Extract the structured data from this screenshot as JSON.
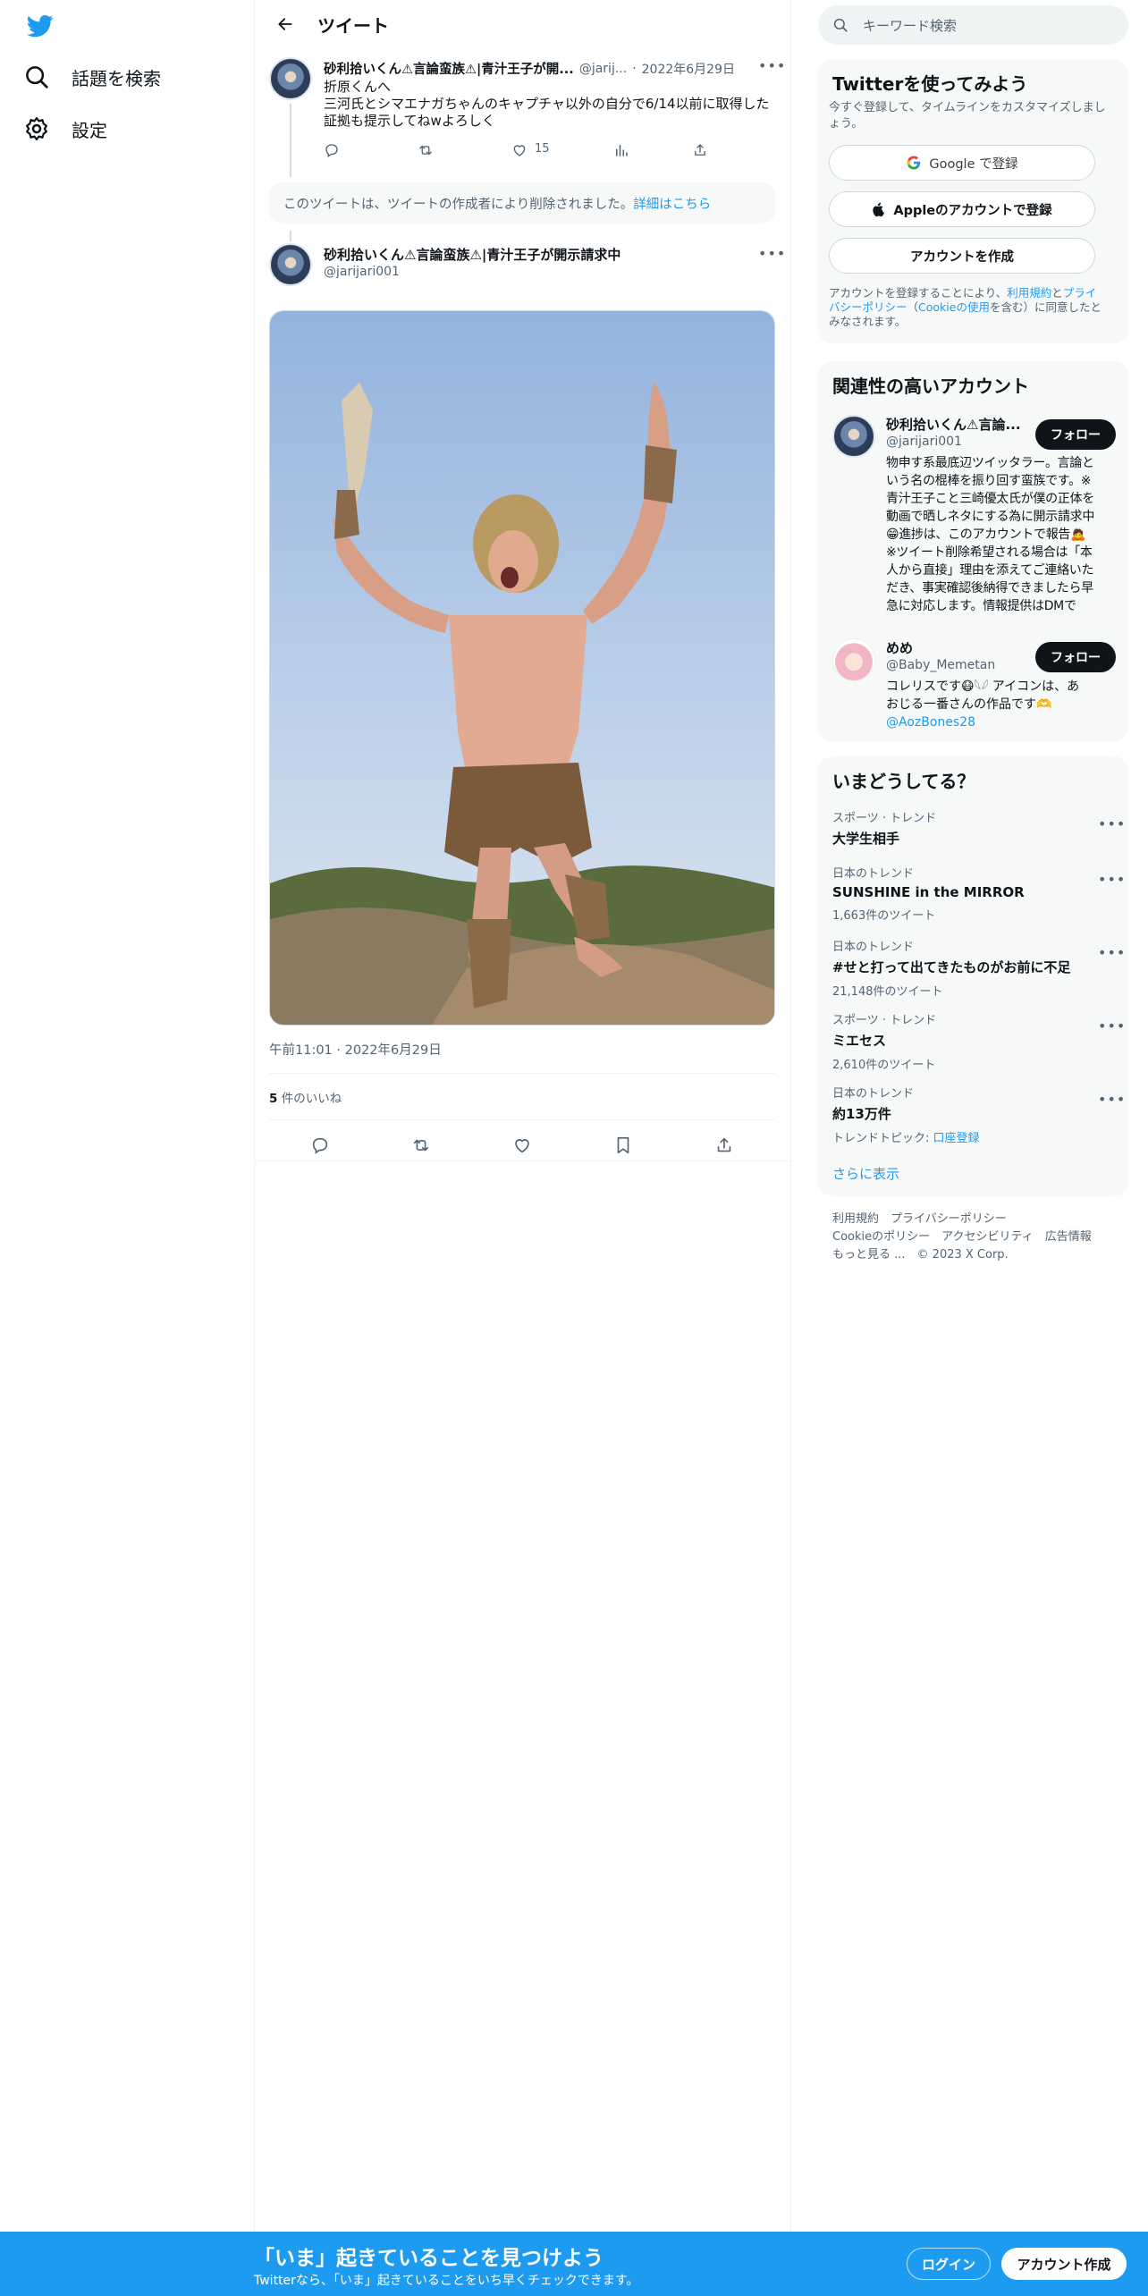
{
  "nav": {
    "items": [
      {
        "label": "話題を検索",
        "icon": "search-icon"
      },
      {
        "label": "設定",
        "icon": "gear-icon"
      }
    ]
  },
  "header": {
    "title": "ツイート"
  },
  "parent_tweet": {
    "name": "砂利拾いくん⚠言論蛮族⚠|青汁王子が開...",
    "handle": "@jarij...",
    "date": "2022年6月29日",
    "text_lines": [
      "折原くんへ",
      "三河氏とシマエナガちゃんのキャプチャ以外の自分で6/14以前に取得した",
      "証拠も提示してねwよろしく"
    ],
    "likes": "15"
  },
  "deleted_notice": {
    "text": "このツイートは、ツイートの作成者により削除されました。",
    "link": "詳細はこちら"
  },
  "main_tweet": {
    "name": "砂利拾いくん⚠言論蛮族⚠|青汁王子が開示請求中",
    "handle": "@jarijari001",
    "time": "午前11:01",
    "date": "2022年6月29日",
    "likes_count": "5",
    "likes_label": "件のいいね"
  },
  "search": {
    "placeholder": "キーワード検索"
  },
  "signup": {
    "title": "Twitterを使ってみよう",
    "subtitle": "今すぐ登録して、タイムラインをカスタマイズしましょう。",
    "google": "Google で登録",
    "apple": "Appleのアカウントで登録",
    "create": "アカウントを作成",
    "legal_lines": [
      {
        "pre": "アカウントを登録することにより、",
        "link": "利用規約",
        "mid": "と",
        "link2": "プライ"
      },
      {
        "link": "バシーポリシー",
        "mid": "（",
        "link2": "Cookieの使用",
        "post": "を含む）に同意したと"
      },
      {
        "post": "みなされます。"
      }
    ]
  },
  "related": {
    "title": "関連性の高いアカウント",
    "accounts": [
      {
        "name": "砂利拾いくん⚠言論...",
        "handle": "@jarijari001",
        "follow": "フォロー",
        "bio_lines": [
          "物申す系最底辺ツイッタラー。言論と",
          "いう名の棍棒を振り回す蛮族です。※",
          "青汁王子こと三崎優太氏が僕の正体を",
          "動画で晒しネタにする為に開示請求中",
          "😁進捗は、このアカウントで報告🙇",
          "※ツイート削除希望される場合は「本",
          "人から直接」理由を添えてご連絡いた",
          "だき、事実確認後納得できましたら早",
          "急に対応します。情報提供はDMで"
        ]
      },
      {
        "name": "めめ",
        "handle": "@Baby_Memetan",
        "follow": "フォロー",
        "bio_lines": [
          "コレリスです😷𓆩𓆪 アイコンは、あ",
          "おじる一番さんの作品です🫶"
        ],
        "link": "@AozBones28"
      }
    ]
  },
  "trends": {
    "title": "いまどうしてる？",
    "items": [
      {
        "category": "スポーツ · トレンド",
        "name": "大学生相手",
        "count": ""
      },
      {
        "category": "日本のトレンド",
        "name": "SUNSHINE in the MIRROR",
        "count": "1,663件のツイート"
      },
      {
        "category": "日本のトレンド",
        "name": "#せと打って出てきたものがお前に不足",
        "count": "21,148件のツイート"
      },
      {
        "category": "スポーツ · トレンド",
        "name": "ミエセス",
        "count": "2,610件のツイート"
      },
      {
        "category": "日本のトレンド",
        "name": "約13万件",
        "count": "トレンドトピック:",
        "topic": "口座登録"
      }
    ],
    "more": "さらに表示"
  },
  "footer": {
    "terms": "利用規約",
    "privacy": "プライバシーポリシー",
    "cookie": "Cookieのポリシー",
    "accessibility": "アクセシビリティ",
    "ads": "広告情報",
    "more": "もっと見る ...",
    "copyright": "© 2023 X Corp."
  },
  "bottom_bar": {
    "headline": "「いま」起きていることを見つけよう",
    "sub": "Twitterなら、「いま」起きていることをいち早くチェックできます。",
    "login": "ログイン",
    "signup": "アカウント作成"
  },
  "colors": {
    "accent": "#1d9bf0",
    "text": "#0f1419",
    "muted": "#536471"
  }
}
